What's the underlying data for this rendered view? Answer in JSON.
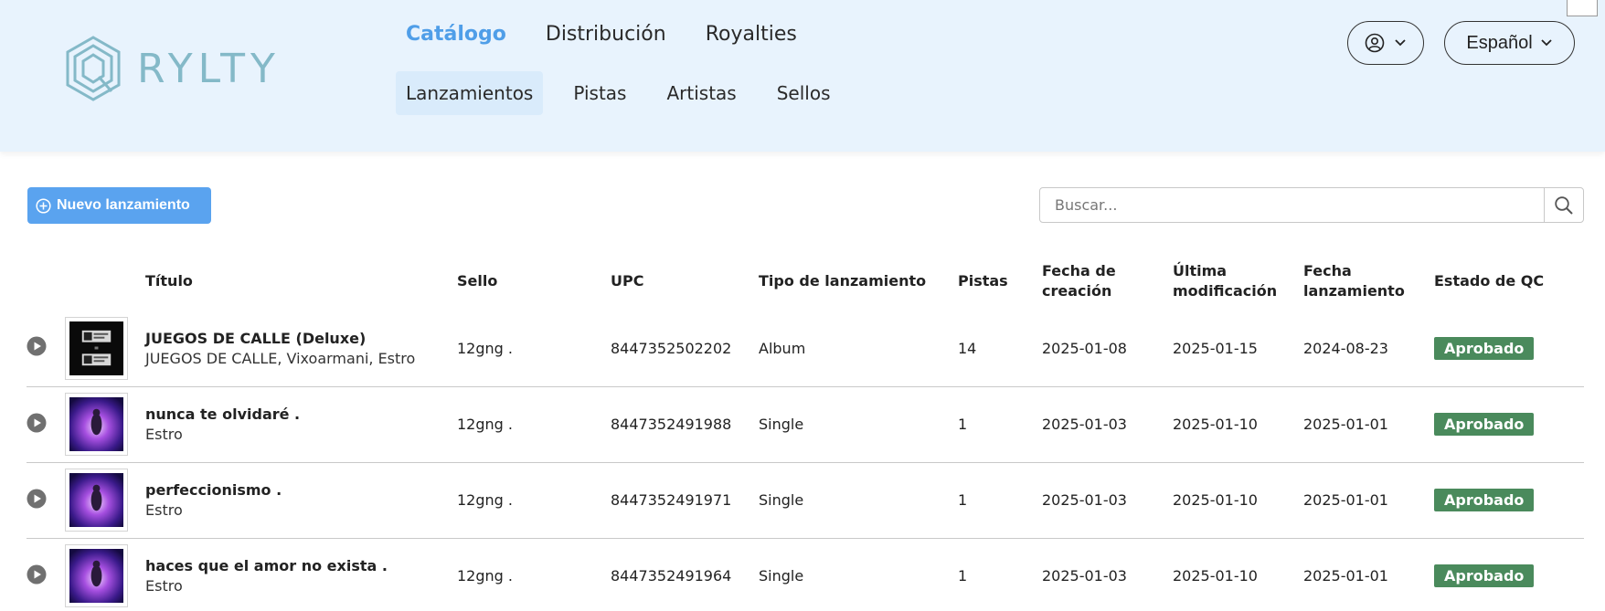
{
  "brand": {
    "name": "RYLTY",
    "logo_icon": "hexagon-logo-icon"
  },
  "top_nav": [
    {
      "label": "Catálogo",
      "active": true
    },
    {
      "label": "Distribución",
      "active": false
    },
    {
      "label": "Royalties",
      "active": false
    }
  ],
  "sub_nav": [
    {
      "label": "Lanzamientos",
      "active": true
    },
    {
      "label": "Pistas",
      "active": false
    },
    {
      "label": "Artistas",
      "active": false
    },
    {
      "label": "Sellos",
      "active": false
    }
  ],
  "user_menu": {
    "icon": "user-circle-icon"
  },
  "language": {
    "label": "Español"
  },
  "toolbar": {
    "new_label": "Nuevo lanzamiento",
    "search_placeholder": "Buscar..."
  },
  "table": {
    "headers": {
      "title": "Título",
      "sello": "Sello",
      "upc": "UPC",
      "tipo": "Tipo de lanzamiento",
      "pistas": "Pistas",
      "fecha_creacion_1": "Fecha de",
      "fecha_creacion_2": "creación",
      "ultima_mod_1": "Última",
      "ultima_mod_2": "modificación",
      "fecha_lanz_1": "Fecha",
      "fecha_lanz_2": "lanzamiento",
      "estado": "Estado de QC"
    },
    "rows": [
      {
        "title": "JUEGOS DE CALLE (Deluxe)",
        "subtitle": "JUEGOS DE CALLE, Vixoarmani, Estro",
        "sello": "12gng .",
        "upc": "8447352502202",
        "tipo": "Album",
        "pistas": "14",
        "fecha_creacion": "2025-01-08",
        "ultima_mod": "2025-01-15",
        "fecha_lanz": "2024-08-23",
        "estado": "Aprobado",
        "cover": "dark"
      },
      {
        "title": "nunca te olvidaré .",
        "subtitle": "Estro",
        "sello": "12gng .",
        "upc": "8447352491988",
        "tipo": "Single",
        "pistas": "1",
        "fecha_creacion": "2025-01-03",
        "ultima_mod": "2025-01-10",
        "fecha_lanz": "2025-01-01",
        "estado": "Aprobado",
        "cover": "purple"
      },
      {
        "title": "perfeccionismo .",
        "subtitle": "Estro",
        "sello": "12gng .",
        "upc": "8447352491971",
        "tipo": "Single",
        "pistas": "1",
        "fecha_creacion": "2025-01-03",
        "ultima_mod": "2025-01-10",
        "fecha_lanz": "2025-01-01",
        "estado": "Aprobado",
        "cover": "purple"
      },
      {
        "title": "haces que el amor no exista .",
        "subtitle": "Estro",
        "sello": "12gng .",
        "upc": "8447352491964",
        "tipo": "Single",
        "pistas": "1",
        "fecha_creacion": "2025-01-03",
        "ultima_mod": "2025-01-10",
        "fecha_lanz": "2025-01-01",
        "estado": "Aprobado",
        "cover": "purple"
      }
    ]
  },
  "colors": {
    "header_bg": "#e8f3fd",
    "accent": "#4f9ee8",
    "button": "#5aa3ef",
    "approved": "#4a8a5c"
  }
}
